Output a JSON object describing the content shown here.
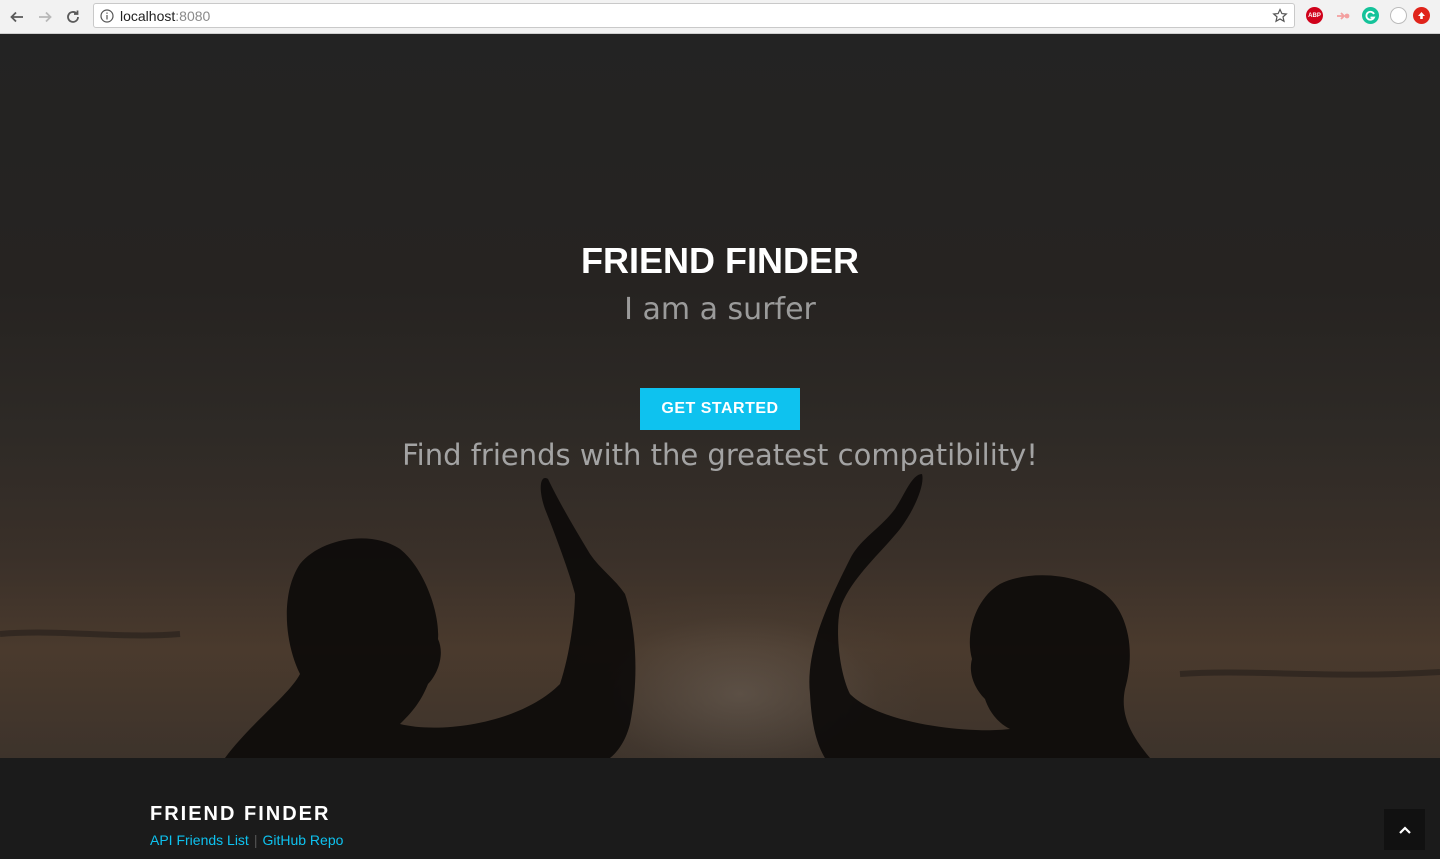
{
  "browser": {
    "url_host": "localhost",
    "url_port": ":8080",
    "extensions": [
      "adblock-plus-icon",
      "share-icon",
      "grammarly-icon",
      "circle-extension-icon",
      "upload-extension-icon"
    ],
    "abp_label": "ABP"
  },
  "hero": {
    "title": "FRIEND FINDER",
    "subtitle": "I am a surfer",
    "cta_label": "GET STARTED",
    "tagline": "Find friends with the greatest compatibility!"
  },
  "footer": {
    "brand": "FRIEND FINDER",
    "links": [
      {
        "label": "API Friends List"
      },
      {
        "label": "GitHub Repo"
      }
    ],
    "separator": "|"
  },
  "colors": {
    "accent": "#0ec2ef",
    "footer_bg": "#1b1b1b",
    "hero_text": "#ffffff",
    "muted_text": "#9b9b9b"
  }
}
